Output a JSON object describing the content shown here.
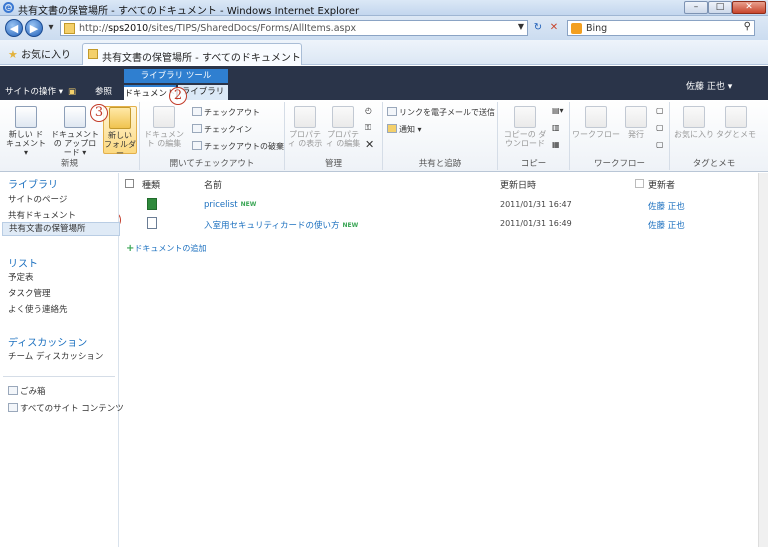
{
  "window": {
    "title": "共有文書の保管場所 - すべてのドキュメント - Windows Internet Explorer",
    "controls": {
      "minimize": "–",
      "maximize": "□",
      "close": "✕"
    }
  },
  "address_bar": {
    "url_prefix": "http://",
    "url_host": "sps2010",
    "url_path": "/sites/TIPS/SharedDocs/Forms/AllItems.aspx",
    "search_engine": "Bing",
    "refresh_icon": "↻",
    "stop_icon": "✕"
  },
  "favorites_bar": {
    "favorites_label": "お気に入り",
    "tab_title": "共有文書の保管場所 - すべてのドキュメント"
  },
  "sharepoint_bar": {
    "site_actions": "サイトの操作 ▾",
    "browse_tab": "参照",
    "context_group": "ライブラリ ツール",
    "tab_documents": "ドキュメント",
    "tab_library": "ライブラリ",
    "user": "佐藤 正也 ▾"
  },
  "ribbon": {
    "groups": {
      "new": "新規",
      "open_checkout": "開いてチェックアウト",
      "manage": "管理",
      "share_track": "共有と追跡",
      "copies": "コピー",
      "workflows": "ワークフロー",
      "tags_notes": "タグとメモ"
    },
    "new_document": "新しい ドキュメント ▾",
    "upload_document": "ドキュメントの アップロード ▾",
    "new_folder": "新しい フォルダー",
    "edit_document": "ドキュメント の編集",
    "check_out": "チェックアウト",
    "check_in": "チェックイン",
    "discard_checkout": "チェックアウトの破棄",
    "view_properties": "プロパティ の表示",
    "edit_properties": "プロパティ の編集",
    "email_link": "リンクを電子メールで送信",
    "alert_me": "通知 ▾",
    "download_copy": "コピーの ダウンロード",
    "workflow": "ワークフロー",
    "publish": "発行",
    "favorites": "お気に入り",
    "tags_notes": "タグとメモ"
  },
  "annotations": {
    "one": "1",
    "two": "2",
    "three": "3"
  },
  "left_nav": {
    "libraries_heading": "ライブラリ",
    "site_pages": "サイトのページ",
    "shared_documents": "共有ドキュメント",
    "shared_archive": "共有文書の保管場所",
    "lists_heading": "リスト",
    "calendar": "予定表",
    "tasks": "タスク管理",
    "contacts": "よく使う連絡先",
    "discussions_heading": "ディスカッション",
    "team_discussion": "チーム ディスカッション",
    "recycle_bin": "ごみ箱",
    "all_site_content": "すべてのサイト コンテンツ"
  },
  "document_list": {
    "columns": {
      "type": "種類",
      "name": "名前",
      "modified": "更新日時",
      "modified_by": "更新者"
    },
    "rows": [
      {
        "name": "pricelist",
        "new_tag": "NEW",
        "modified": "2011/01/31 16:47",
        "modified_by": "佐藤 正也"
      },
      {
        "name": "入室用セキュリティカードの使い方",
        "new_tag": "NEW",
        "modified": "2011/01/31 16:49",
        "modified_by": "佐藤 正也"
      }
    ],
    "add_document": "ドキュメントの追加"
  }
}
